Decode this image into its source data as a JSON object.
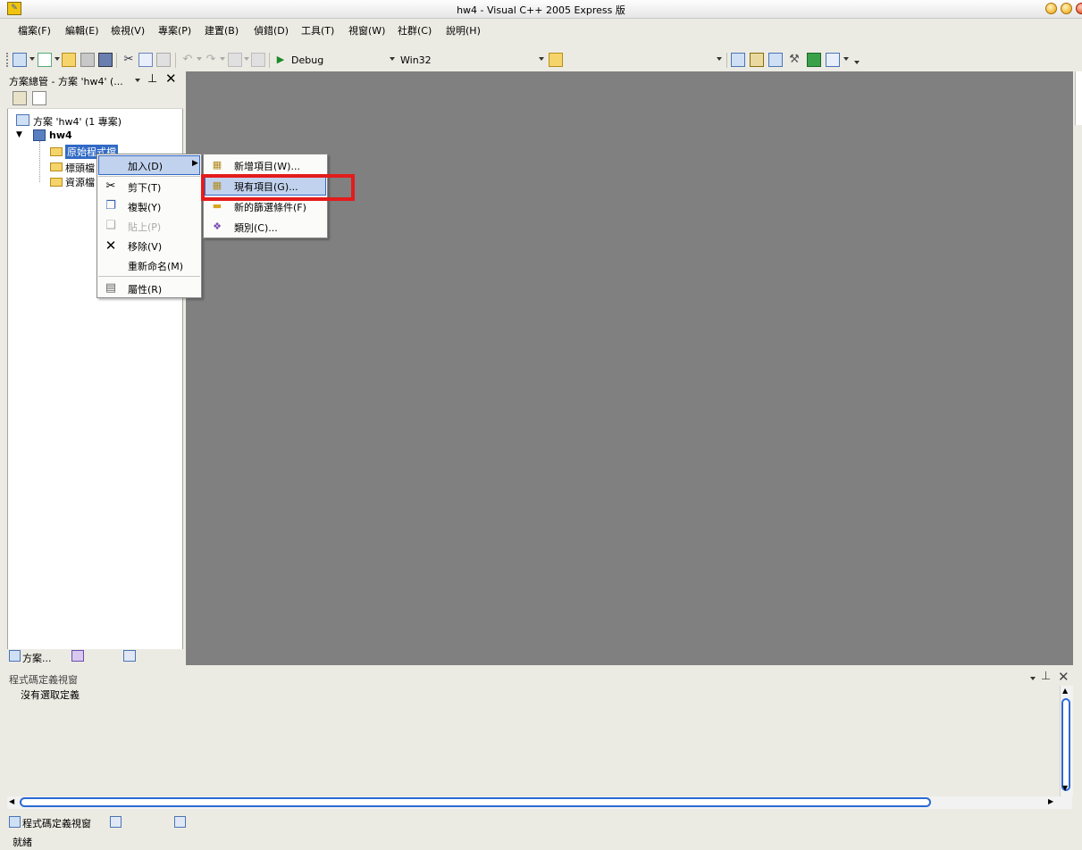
{
  "window": {
    "title": "hw4 - Visual C++ 2005 Express 版"
  },
  "menubar": {
    "items": [
      "檔案(F)",
      "編輯(E)",
      "檢視(V)",
      "專案(P)",
      "建置(B)",
      "偵錯(D)",
      "工具(T)",
      "視窗(W)",
      "社群(C)",
      "說明(H)"
    ]
  },
  "toolbar": {
    "config": "Debug",
    "platform": "Win32"
  },
  "solution_explorer": {
    "title": "方案總管 - 方案 'hw4' (...",
    "solution": "方案 'hw4' (1 專案)",
    "project": "hw4",
    "folders": [
      "原始程式檔",
      "標頭檔",
      "資源檔"
    ],
    "tab_label": "方案..."
  },
  "context_menu": {
    "items": [
      "加入(D)",
      "剪下(T)",
      "複製(Y)",
      "貼上(P)",
      "移除(V)",
      "重新命名(M)",
      "屬性(R)"
    ]
  },
  "submenu": {
    "items": [
      "新增項目(W)...",
      "現有項目(G)...",
      "新的篩選條件(F)",
      "類別(C)..."
    ]
  },
  "code_def": {
    "title": "程式碼定義視窗",
    "message": "沒有選取定義",
    "tab_label": "程式碼定義視窗"
  },
  "status": {
    "text": "就緒"
  }
}
